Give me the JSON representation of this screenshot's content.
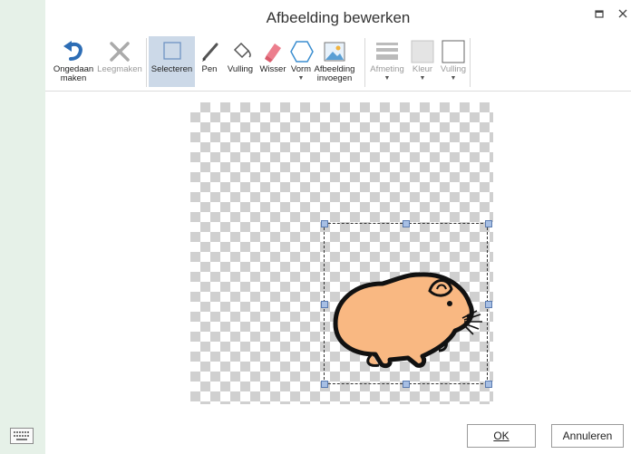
{
  "dialog": {
    "title": "Afbeelding bewerken"
  },
  "toolbar": {
    "undo_line1": "Ongedaan",
    "undo_line2": "maken",
    "clear": "Leegmaken",
    "select": "Selecteren",
    "pen": "Pen",
    "fill": "Vulling",
    "eraser": "Wisser",
    "shape": "Vorm",
    "insert_line1": "Afbeelding",
    "insert_line2": "invoegen",
    "size": "Afmeting",
    "color": "Kleur",
    "fill2": "Vulling"
  },
  "footer": {
    "ok": "OK",
    "cancel": "Annuleren"
  },
  "colors": {
    "accent": "#2d6db5",
    "selected_tool_bg": "#ccd9e8",
    "guinea_pig_fill": "#f9b882"
  }
}
